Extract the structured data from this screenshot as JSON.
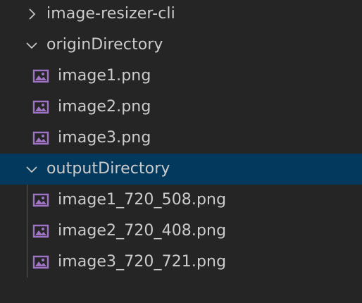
{
  "tree": {
    "root_folder": {
      "label": "image-resizer-cli",
      "expanded": false
    },
    "origin_folder": {
      "label": "originDirectory",
      "expanded": true,
      "files": [
        {
          "label": "image1.png",
          "icon": "image-file-icon"
        },
        {
          "label": "image2.png",
          "icon": "image-file-icon"
        },
        {
          "label": "image3.png",
          "icon": "image-file-icon"
        }
      ]
    },
    "output_folder": {
      "label": "outputDirectory",
      "expanded": true,
      "selected": true,
      "files": [
        {
          "label": "image1_720_508.png",
          "icon": "image-file-icon"
        },
        {
          "label": "image2_720_408.png",
          "icon": "image-file-icon"
        },
        {
          "label": "image3_720_721.png",
          "icon": "image-file-icon"
        }
      ]
    }
  },
  "colors": {
    "background": "#252526",
    "selected_row": "#04395e",
    "text": "#cccccc",
    "icon_purple": "#a074c4",
    "indent_guide": "#585858"
  }
}
